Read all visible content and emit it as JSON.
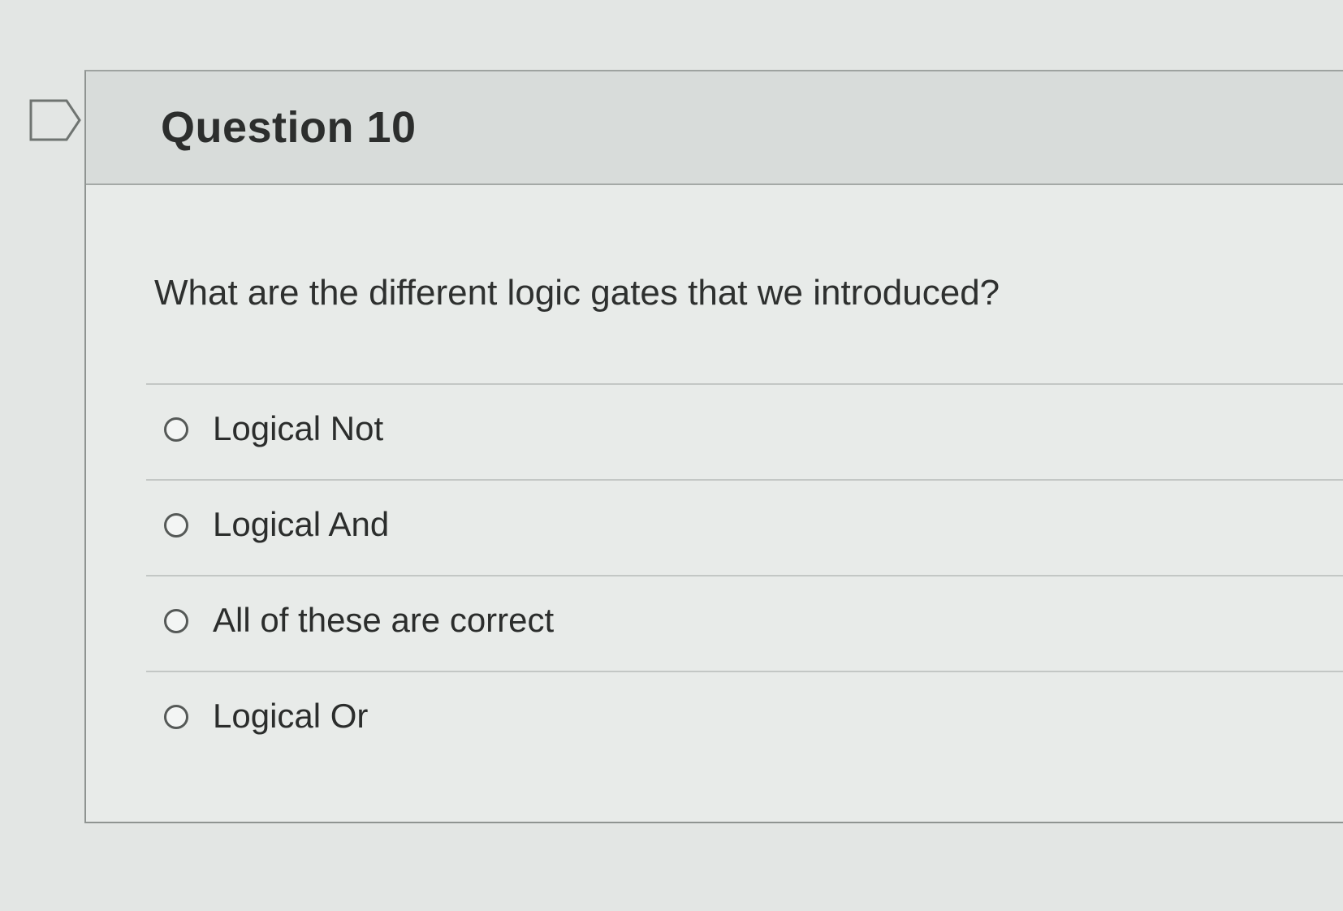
{
  "question": {
    "title": "Question 10",
    "text": "What are the different logic gates that we introduced?",
    "answers": [
      {
        "label": "Logical Not",
        "selected": false
      },
      {
        "label": "Logical And",
        "selected": false
      },
      {
        "label": "All of these are correct",
        "selected": false
      },
      {
        "label": "Logical Or",
        "selected": false
      }
    ]
  },
  "icons": {
    "flag": "flag-question-icon",
    "radio": "radio-button-icon"
  },
  "colors": {
    "background": "#e3e6e4",
    "header": "#d8dcda",
    "text": "#2c2e2d",
    "border": "#8f9491"
  }
}
